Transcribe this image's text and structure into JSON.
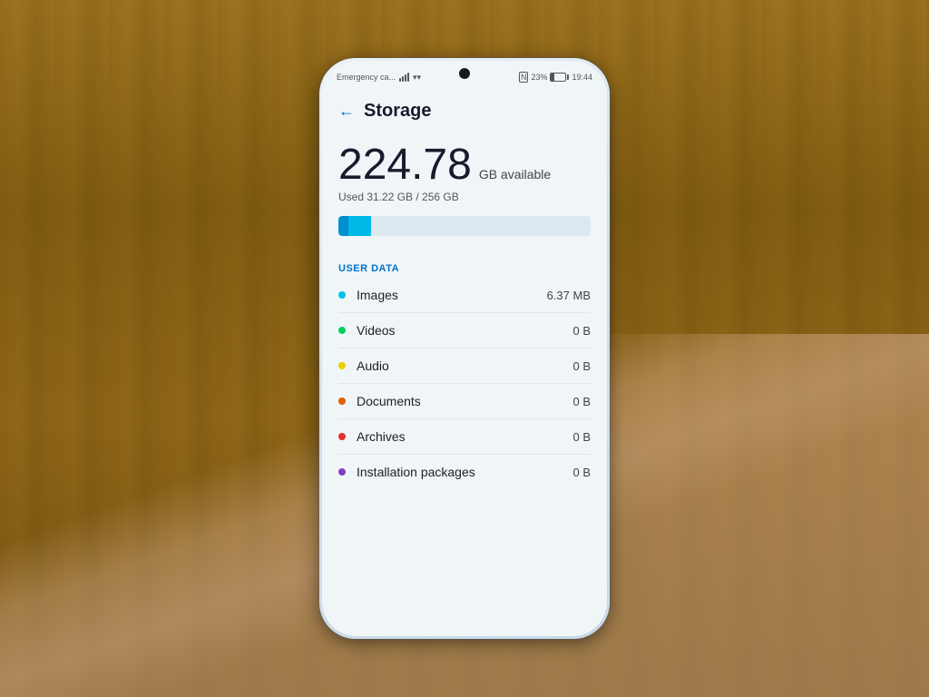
{
  "background": {
    "wood_color": "#8B6914"
  },
  "status_bar": {
    "left_text": "Emergency ca...",
    "nfc_label": "N",
    "battery_percent": "23%",
    "time": "19:44"
  },
  "header": {
    "back_label": "←",
    "title": "Storage"
  },
  "storage": {
    "available_number": "224.78",
    "available_unit": "GB available",
    "used_label": "Used 31.22 GB / 256 GB"
  },
  "section": {
    "label": "USER DATA"
  },
  "items": [
    {
      "name": "Images",
      "size": "6.37 MB",
      "dot_color": "#00c0e8"
    },
    {
      "name": "Videos",
      "size": "0 B",
      "dot_color": "#00d060"
    },
    {
      "name": "Audio",
      "size": "0 B",
      "dot_color": "#e8d000"
    },
    {
      "name": "Documents",
      "size": "0 B",
      "dot_color": "#e06000"
    },
    {
      "name": "Archives",
      "size": "0 B",
      "dot_color": "#e03030"
    },
    {
      "name": "Installation packages",
      "size": "0 B",
      "dot_color": "#8040c0"
    }
  ]
}
